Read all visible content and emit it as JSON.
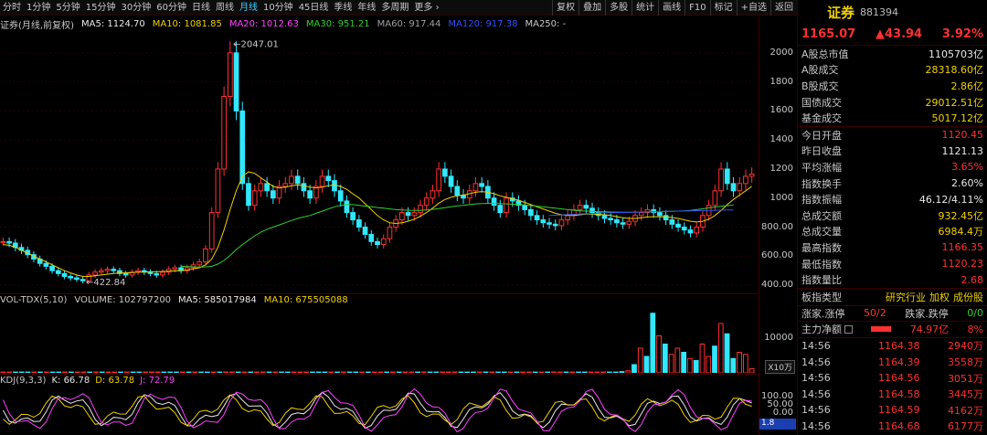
{
  "toolbar": {
    "tabs": [
      "分时",
      "1分钟",
      "5分钟",
      "15分钟",
      "30分钟",
      "60分钟",
      "日线",
      "周线",
      "月线",
      "10分钟",
      "45日线",
      "季线",
      "年线",
      "多周期",
      "更多 ›"
    ],
    "active_tab": "月线",
    "tools": [
      "复权",
      "叠加",
      "多股",
      "统计",
      "画线",
      "F10",
      "标记",
      "+自选",
      "返回"
    ]
  },
  "ma_bar": {
    "title": "证券(月线,前复权)",
    "ma5": "MA5: 1124.70",
    "ma10": "MA10: 1081.85",
    "ma20": "MA20: 1012.63",
    "ma30": "MA30: 951.21",
    "ma60": "MA60: 917.44",
    "ma120": "MA120: 917.38",
    "ma250": "MA250: -"
  },
  "colors": {
    "up": "#ff3030",
    "down": "#30e8ff",
    "ma5": "#e8e8e8",
    "ma10": "#f0d000",
    "ma20": "#ff40ff",
    "ma30": "#30d030",
    "ma60": "#a0a0a0",
    "ma120": "#3050ff"
  },
  "chart_data": {
    "type": "candlestick",
    "title": "证券(月线,前复权)",
    "ylim": [
      350,
      2150
    ],
    "y_ticks": [
      400,
      600,
      800,
      1000,
      1200,
      1400,
      1600,
      1800,
      2000
    ],
    "y_tick_labels": [
      "400.00",
      "600.00",
      "800.00",
      "1000",
      "1200",
      "1400",
      "1600",
      "1800",
      "2000"
    ],
    "annotations": {
      "high": "2047.01",
      "low": "422.84"
    },
    "closes": [
      700,
      690,
      660,
      640,
      610,
      580,
      550,
      530,
      500,
      480,
      460,
      450,
      440,
      430,
      470,
      490,
      500,
      510,
      500,
      480,
      470,
      490,
      500,
      490,
      480,
      470,
      490,
      510,
      520,
      500,
      520,
      540,
      560,
      650,
      900,
      1200,
      1700,
      2000,
      1600,
      1100,
      950,
      1050,
      1100,
      1050,
      1000,
      1080,
      1100,
      1150,
      1100,
      1050,
      1000,
      1080,
      1150,
      1120,
      1050,
      980,
      900,
      850,
      800,
      750,
      700,
      680,
      720,
      800,
      850,
      900,
      880,
      900,
      950,
      1000,
      1050,
      1200,
      1150,
      1080,
      1020,
      1000,
      1050,
      1100,
      1080,
      1000,
      950,
      900,
      1000,
      980,
      950,
      920,
      880,
      850,
      830,
      820,
      810,
      850,
      880,
      920,
      950,
      930,
      900,
      880,
      860,
      850,
      830,
      820,
      840,
      880,
      900,
      920,
      900,
      880,
      850,
      820,
      800,
      780,
      760,
      800,
      880,
      950,
      1050,
      1200,
      1100,
      1050,
      1100,
      1150,
      1165
    ],
    "ma10": [
      680,
      675,
      660,
      640,
      620,
      600,
      580,
      560,
      540,
      520,
      500,
      485,
      470,
      460,
      460,
      465,
      470,
      475,
      480,
      485,
      485,
      487,
      490,
      490,
      492,
      493,
      494,
      496,
      498,
      500,
      505,
      512,
      520,
      540,
      580,
      660,
      780,
      920,
      1050,
      1150,
      1180,
      1170,
      1140,
      1110,
      1080,
      1070,
      1075,
      1085,
      1090,
      1085,
      1075,
      1070,
      1075,
      1085,
      1090,
      1080,
      1060,
      1030,
      1000,
      960,
      920,
      880,
      850,
      830,
      825,
      830,
      840,
      855,
      875,
      900,
      930,
      965,
      990,
      1005,
      1015,
      1020,
      1030,
      1040,
      1045,
      1040,
      1030,
      1015,
      1005,
      995,
      985,
      970,
      955,
      940,
      925,
      910,
      895,
      885,
      880,
      880,
      885,
      890,
      890,
      888,
      885,
      880,
      872,
      865,
      860,
      860,
      865,
      870,
      872,
      872,
      870,
      866,
      860,
      850,
      840,
      835,
      840,
      855,
      880,
      915,
      955,
      990,
      1020,
      1050,
      1081
    ],
    "ma30": [
      null,
      null,
      null,
      null,
      null,
      null,
      null,
      null,
      null,
      null,
      null,
      null,
      null,
      null,
      null,
      null,
      null,
      null,
      null,
      null,
      null,
      null,
      null,
      null,
      null,
      null,
      null,
      null,
      null,
      530,
      528,
      526,
      525,
      526,
      530,
      545,
      570,
      605,
      645,
      680,
      710,
      740,
      765,
      785,
      800,
      815,
      830,
      845,
      860,
      870,
      880,
      895,
      910,
      925,
      940,
      950,
      955,
      955,
      950,
      945,
      940,
      935,
      930,
      925,
      920,
      918,
      916,
      915,
      915,
      918,
      922,
      928,
      934,
      940,
      946,
      950,
      955,
      960,
      962,
      963,
      963,
      962,
      960,
      958,
      955,
      952,
      948,
      944,
      940,
      935,
      930,
      925,
      920,
      916,
      912,
      910,
      908,
      906,
      905,
      904,
      903,
      902,
      902,
      903,
      904,
      905,
      906,
      907,
      908,
      909,
      910,
      912,
      915,
      920,
      926,
      932,
      938,
      944,
      948,
      951
    ],
    "ma120": [
      null,
      null,
      null,
      null,
      null,
      null,
      null,
      null,
      null,
      null,
      null,
      null,
      null,
      null,
      null,
      null,
      null,
      null,
      null,
      null,
      null,
      null,
      null,
      null,
      null,
      null,
      null,
      null,
      null,
      null,
      null,
      null,
      null,
      null,
      null,
      null,
      null,
      null,
      null,
      null,
      null,
      null,
      null,
      null,
      null,
      null,
      null,
      null,
      null,
      null,
      null,
      null,
      null,
      null,
      null,
      null,
      null,
      null,
      null,
      null,
      null,
      null,
      null,
      null,
      null,
      null,
      null,
      null,
      null,
      null,
      null,
      null,
      null,
      null,
      null,
      null,
      null,
      null,
      null,
      null,
      null,
      null,
      null,
      null,
      null,
      null,
      null,
      null,
      null,
      880,
      882,
      884,
      886,
      888,
      890,
      892,
      894,
      896,
      898,
      899,
      900,
      901,
      902,
      903,
      904,
      905,
      906,
      907,
      908,
      909,
      910,
      911,
      912,
      913,
      914,
      915,
      916,
      917,
      917.38,
      917.4
    ]
  },
  "vol_bar": {
    "title": "VOL-TDX(5,10)",
    "volume": "VOLUME: 102797200",
    "ma5": "MA5: 585017984",
    "ma10": "MA10: 675505088"
  },
  "vol_chart_data": {
    "type": "bar",
    "ylim": [
      0,
      16000
    ],
    "y_tick_labels": [
      "10000"
    ],
    "unit": "X10万",
    "values": [
      200,
      200,
      200,
      200,
      200,
      200,
      200,
      200,
      200,
      200,
      200,
      200,
      200,
      200,
      200,
      200,
      200,
      200,
      200,
      200,
      200,
      200,
      200,
      200,
      200,
      200,
      200,
      200,
      200,
      200,
      200,
      200,
      200,
      200,
      200,
      200,
      200,
      200,
      200,
      200,
      200,
      200,
      200,
      200,
      200,
      200,
      200,
      200,
      200,
      200,
      200,
      200,
      200,
      200,
      200,
      200,
      200,
      200,
      200,
      200,
      200,
      200,
      200,
      200,
      200,
      200,
      200,
      200,
      200,
      200,
      200,
      200,
      200,
      200,
      200,
      200,
      200,
      200,
      200,
      200,
      200,
      200,
      200,
      200,
      200,
      200,
      200,
      200,
      200,
      200,
      200,
      200,
      200,
      200,
      200,
      200,
      200,
      200,
      200,
      200,
      300,
      500,
      2000,
      6000,
      4000,
      14500,
      9000,
      7000,
      4500,
      6000,
      5000,
      3500,
      3000,
      7000,
      4000,
      6500,
      12000,
      9500,
      3500,
      5000,
      4500,
      1000
    ],
    "up_flags": [
      1,
      1,
      0,
      0,
      0,
      1,
      0,
      1,
      0,
      0,
      1,
      0,
      1,
      1,
      0,
      1,
      0,
      1,
      1,
      0,
      1,
      0,
      0,
      1
    ]
  },
  "kdj_bar": {
    "title": "KDJ(9,3,3)",
    "k": "K: 66.78",
    "d": "D: 63.78",
    "j": "J: 72.79"
  },
  "kdj_axis": {
    "labels": [
      "100.00",
      "50.00",
      "0.00"
    ],
    "selected": "1.8"
  },
  "panel": {
    "name": "证券",
    "code": "881394",
    "price": "1165.07",
    "change": "▲43.94",
    "pct": "3.92%",
    "rows1": [
      {
        "k": "A股总市值",
        "v": "1105703亿",
        "c": "white"
      },
      {
        "k": "A股成交",
        "v": "28318.60亿",
        "c": "yellow"
      },
      {
        "k": "B股成交",
        "v": "2.86亿",
        "c": "yellow"
      },
      {
        "k": "国债成交",
        "v": "29012.51亿",
        "c": "yellow"
      },
      {
        "k": "基金成交",
        "v": "5017.12亿",
        "c": "yellow"
      }
    ],
    "rows2": [
      {
        "k": "今日开盘",
        "v": "1120.45",
        "c": "red"
      },
      {
        "k": "昨日收盘",
        "v": "1121.13",
        "c": "white"
      },
      {
        "k": "平均涨幅",
        "v": "3.65%",
        "c": "red"
      },
      {
        "k": "指数换手",
        "v": "2.60%",
        "c": "white"
      },
      {
        "k": "指数振幅",
        "v": "46.12/4.11%",
        "c": "white"
      },
      {
        "k": "总成交额",
        "v": "932.45亿",
        "c": "yellow"
      },
      {
        "k": "总成交量",
        "v": "6984.4万",
        "c": "yellow"
      },
      {
        "k": "最高指数",
        "v": "1166.35",
        "c": "red"
      },
      {
        "k": "最低指数",
        "v": "1120.23",
        "c": "red"
      },
      {
        "k": "指数量比",
        "v": "2.68",
        "c": "red"
      }
    ],
    "board": {
      "k": "板指类型",
      "v1": "研究行业",
      "v2": "加权",
      "v3": "成份股"
    },
    "updown": {
      "k1": "涨家.涨停",
      "v1": "50/2",
      "k2": "跌家.跌停",
      "v2": "0/0"
    },
    "fund": {
      "k": "主力净额",
      "v": "74.97亿",
      "pct": "8%"
    },
    "ticks": [
      {
        "t": "14:56",
        "p": "1164.38",
        "v": "2940万"
      },
      {
        "t": "14:56",
        "p": "1164.39",
        "v": "3558万"
      },
      {
        "t": "14:56",
        "p": "1164.56",
        "v": "3051万"
      },
      {
        "t": "14:56",
        "p": "1164.58",
        "v": "3445万"
      },
      {
        "t": "14:56",
        "p": "1164.59",
        "v": "4162万"
      },
      {
        "t": "14:56",
        "p": "1164.68",
        "v": "6177万"
      }
    ]
  }
}
